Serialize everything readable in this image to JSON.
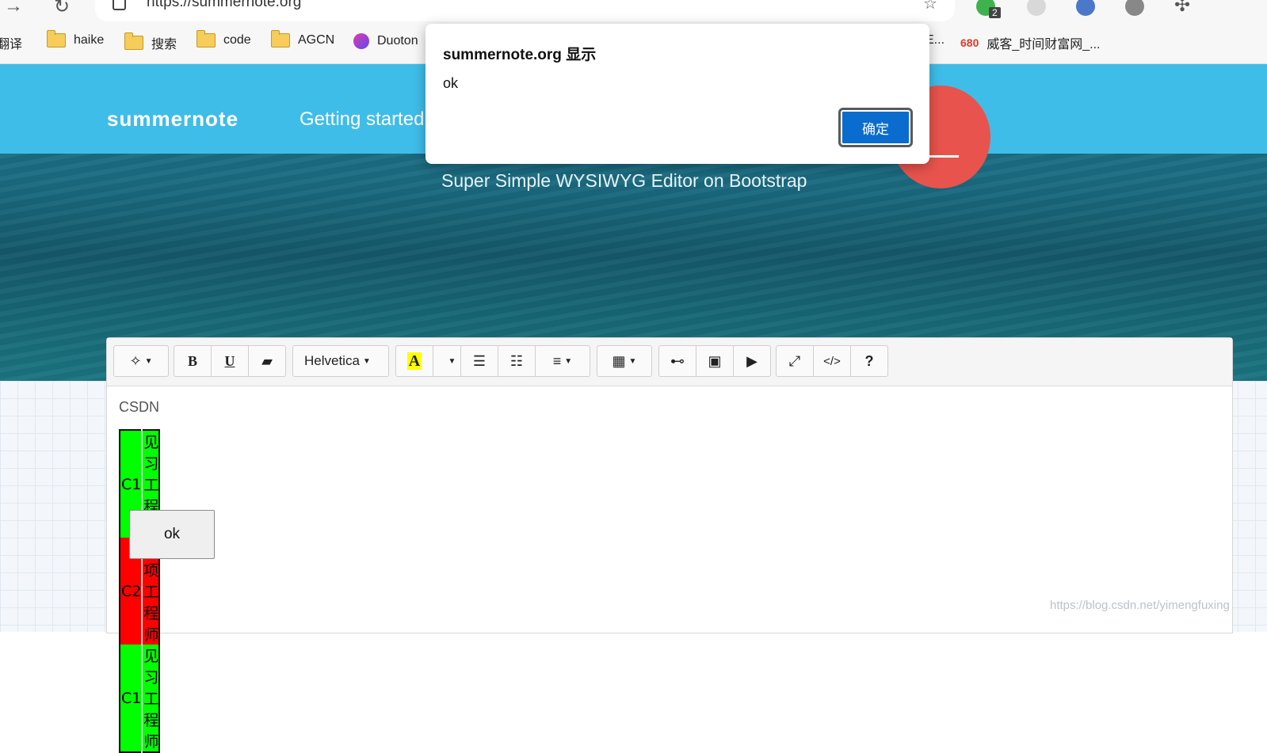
{
  "browser": {
    "url": "https://summernote.org",
    "extension_badge": "2",
    "bookmarks": [
      {
        "label": "翻译",
        "icon": "none"
      },
      {
        "label": "haike",
        "icon": "folder-icon"
      },
      {
        "label": "搜索",
        "icon": "folder-icon"
      },
      {
        "label": "code",
        "icon": "folder-icon"
      },
      {
        "label": "AGCN",
        "icon": "folder-icon"
      },
      {
        "label": "Duoton",
        "icon": "duotone-icon"
      },
      {
        "label": "E...",
        "icon": "none"
      },
      {
        "label": "威客_时间财富网_...",
        "icon": "badge-680",
        "badge": "680"
      }
    ]
  },
  "site": {
    "logo": "summernote",
    "nav_link": "Getting started",
    "tagline": "Super Simple WYSIWYG Editor on Bootstrap"
  },
  "toolbar": {
    "font_name": "Helvetica"
  },
  "editor": {
    "text": "CSDN",
    "table_rows": [
      {
        "c1": "C1",
        "c2": "见习工程师",
        "color": "#00ff00"
      },
      {
        "c1": "C2",
        "c2": "专项工程师",
        "color": "#ff0000"
      },
      {
        "c1": "C1",
        "c2": "见习工程师",
        "color": "#00ff00"
      }
    ],
    "button_label": "ok"
  },
  "dialog": {
    "title": "summernote.org 显示",
    "message": "ok",
    "confirm": "确定"
  },
  "watermark": "https://blog.csdn.net/yimengfuxing",
  "colors": {
    "header": "#3fbde9",
    "dialog_button": "#0a6ccf",
    "download_circle": "#e9534d"
  }
}
